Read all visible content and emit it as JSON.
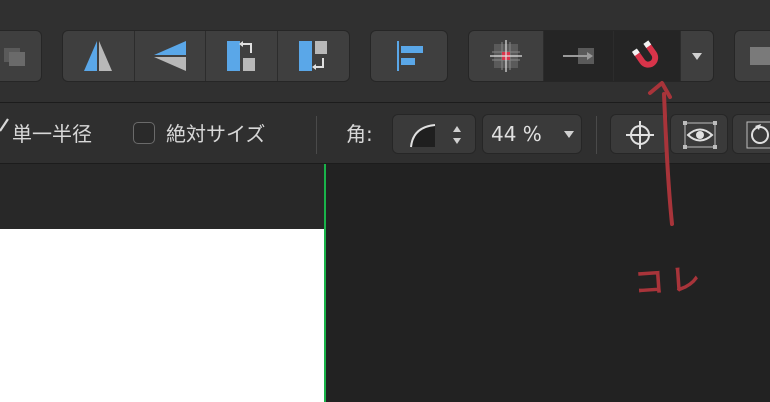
{
  "context_bar": {
    "single_radius_label": "単一半径",
    "absolute_size_label": "絶対サイズ",
    "angle_label": "角:",
    "percent_value": "44 %"
  },
  "annotation": {
    "note_text": "コレ",
    "color": "#a8343a"
  },
  "colors": {
    "accent_blue": "#5aa7e8",
    "magnet_red": "#d8344a",
    "guide_green": "#19b34a"
  },
  "icons": [
    "flip-horizontal-icon",
    "flip-vertical-icon",
    "rotate-left-icon",
    "rotate-right-icon",
    "align-left-icon",
    "snap-grid-icon",
    "snap-arrow-icon",
    "magnet-icon",
    "chevron-down-icon",
    "crosshair-icon",
    "eye-icon",
    "rotate-icon"
  ]
}
